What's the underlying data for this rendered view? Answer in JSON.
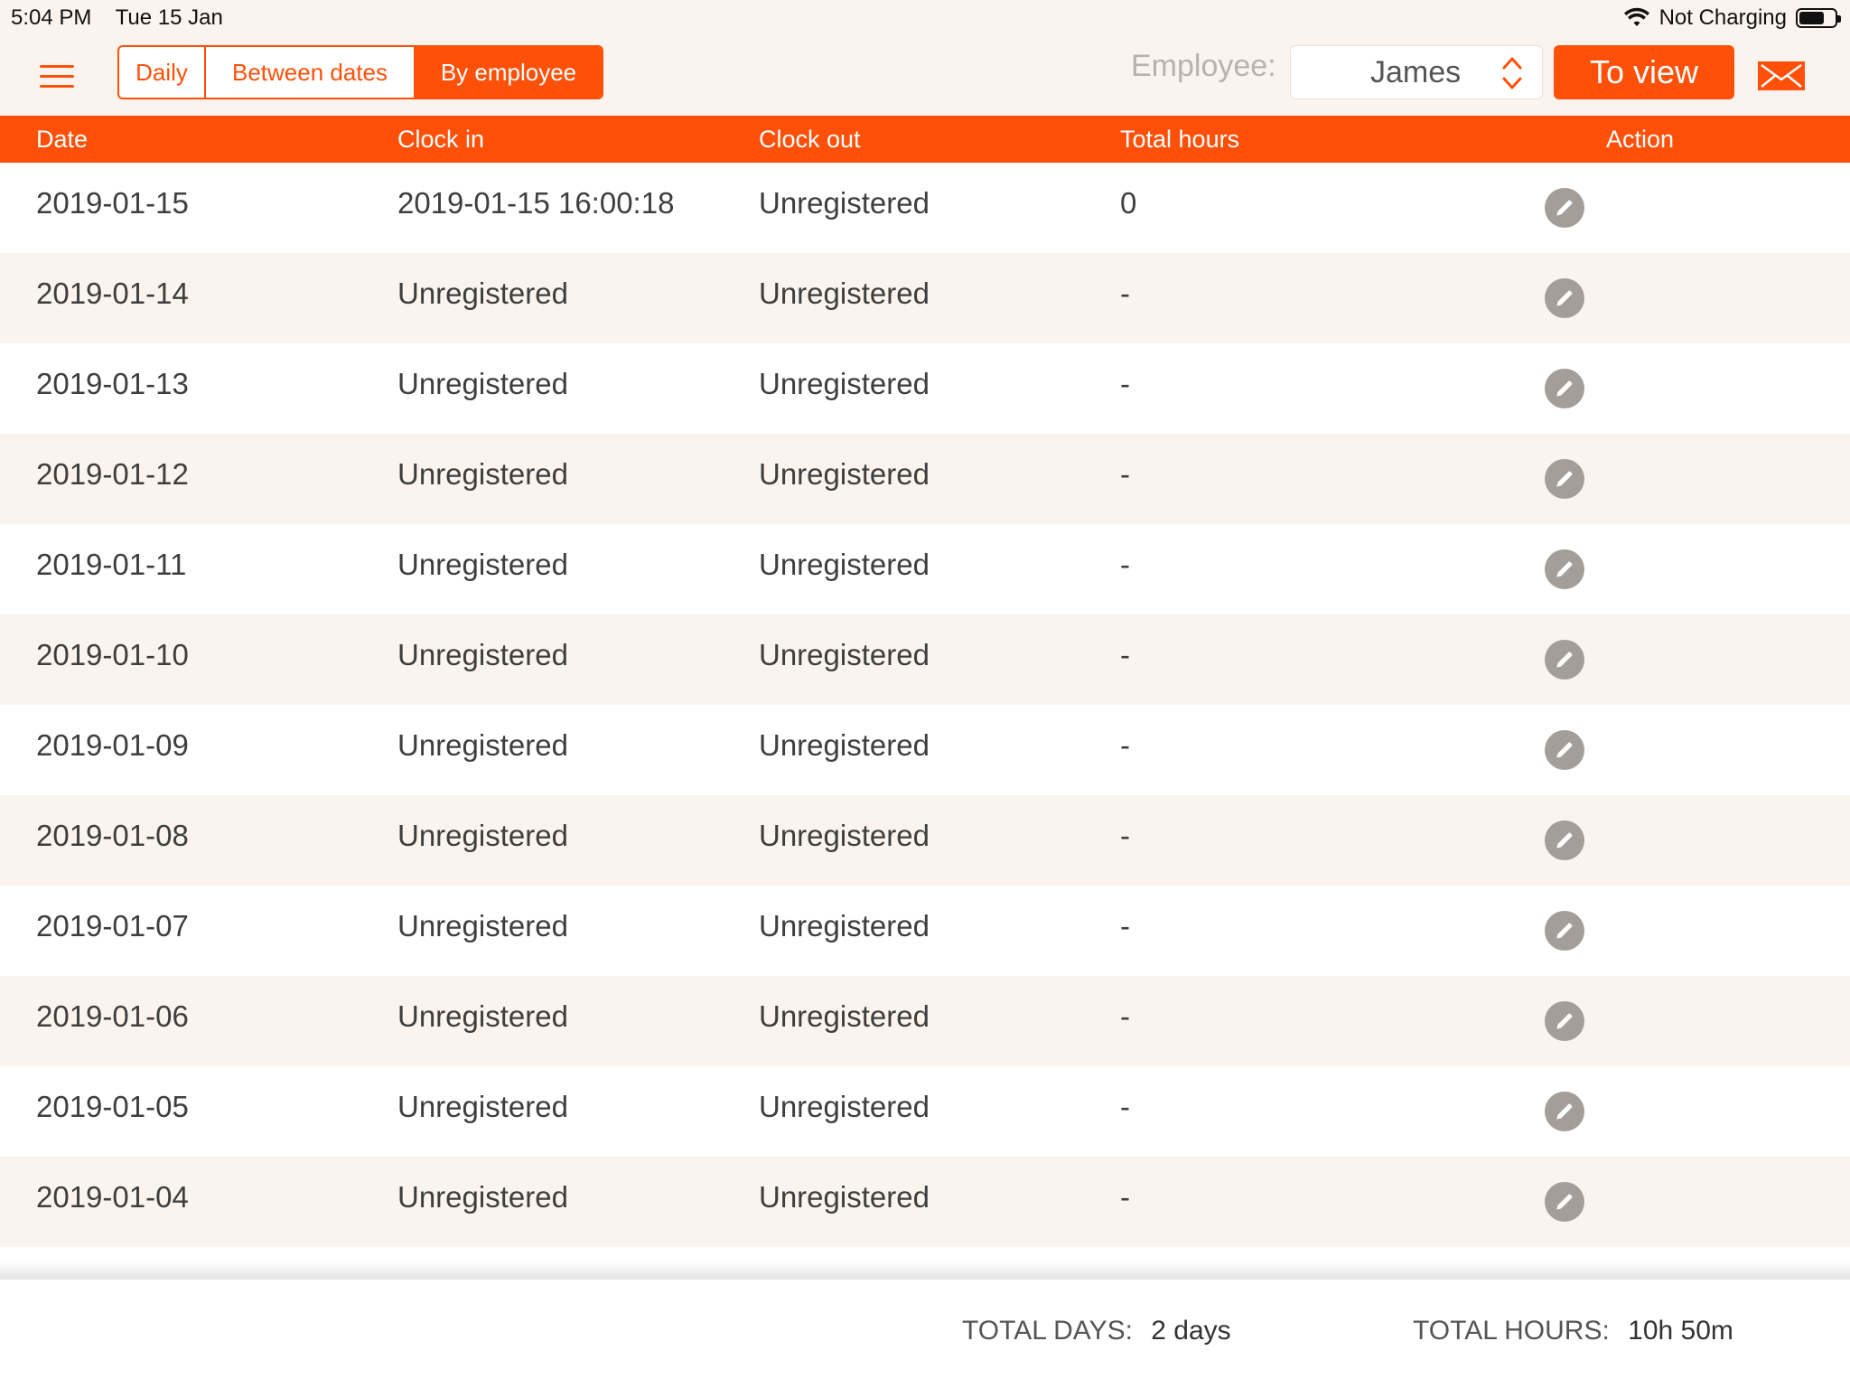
{
  "status_bar": {
    "time": "5:04 PM",
    "date": "Tue 15 Jan",
    "battery_text": "Not Charging"
  },
  "toolbar": {
    "segments": [
      "Daily",
      "Between dates",
      "By employee"
    ],
    "active_segment": "By employee",
    "employee_label": "Employee:",
    "employee_value": "James",
    "view_button": "To view"
  },
  "table": {
    "headers": {
      "date": "Date",
      "clock_in": "Clock in",
      "clock_out": "Clock out",
      "total_hours": "Total hours",
      "action": "Action"
    },
    "rows": [
      {
        "date": "2019-01-15",
        "clock_in": "2019-01-15 16:00:18",
        "clock_out": "Unregistered",
        "total": "0"
      },
      {
        "date": "2019-01-14",
        "clock_in": "Unregistered",
        "clock_out": "Unregistered",
        "total": "-"
      },
      {
        "date": "2019-01-13",
        "clock_in": "Unregistered",
        "clock_out": "Unregistered",
        "total": "-"
      },
      {
        "date": "2019-01-12",
        "clock_in": "Unregistered",
        "clock_out": "Unregistered",
        "total": "-"
      },
      {
        "date": "2019-01-11",
        "clock_in": "Unregistered",
        "clock_out": "Unregistered",
        "total": "-"
      },
      {
        "date": "2019-01-10",
        "clock_in": "Unregistered",
        "clock_out": "Unregistered",
        "total": "-"
      },
      {
        "date": "2019-01-09",
        "clock_in": "Unregistered",
        "clock_out": "Unregistered",
        "total": "-"
      },
      {
        "date": "2019-01-08",
        "clock_in": "Unregistered",
        "clock_out": "Unregistered",
        "total": "-"
      },
      {
        "date": "2019-01-07",
        "clock_in": "Unregistered",
        "clock_out": "Unregistered",
        "total": "-"
      },
      {
        "date": "2019-01-06",
        "clock_in": "Unregistered",
        "clock_out": "Unregistered",
        "total": "-"
      },
      {
        "date": "2019-01-05",
        "clock_in": "Unregistered",
        "clock_out": "Unregistered",
        "total": "-"
      },
      {
        "date": "2019-01-04",
        "clock_in": "Unregistered",
        "clock_out": "Unregistered",
        "total": "-"
      }
    ]
  },
  "footer": {
    "total_days_label": "TOTAL DAYS:",
    "total_days_value": "2 days",
    "total_hours_label": "TOTAL HOURS:",
    "total_hours_value": "10h 50m"
  },
  "colors": {
    "accent": "#ff5009",
    "row_alt": "#fbf4ee",
    "edit_icon": "#a39e99"
  },
  "icons": [
    "wifi-icon",
    "battery-icon",
    "menu-icon",
    "stepper-icon",
    "mail-icon",
    "edit-icon"
  ]
}
